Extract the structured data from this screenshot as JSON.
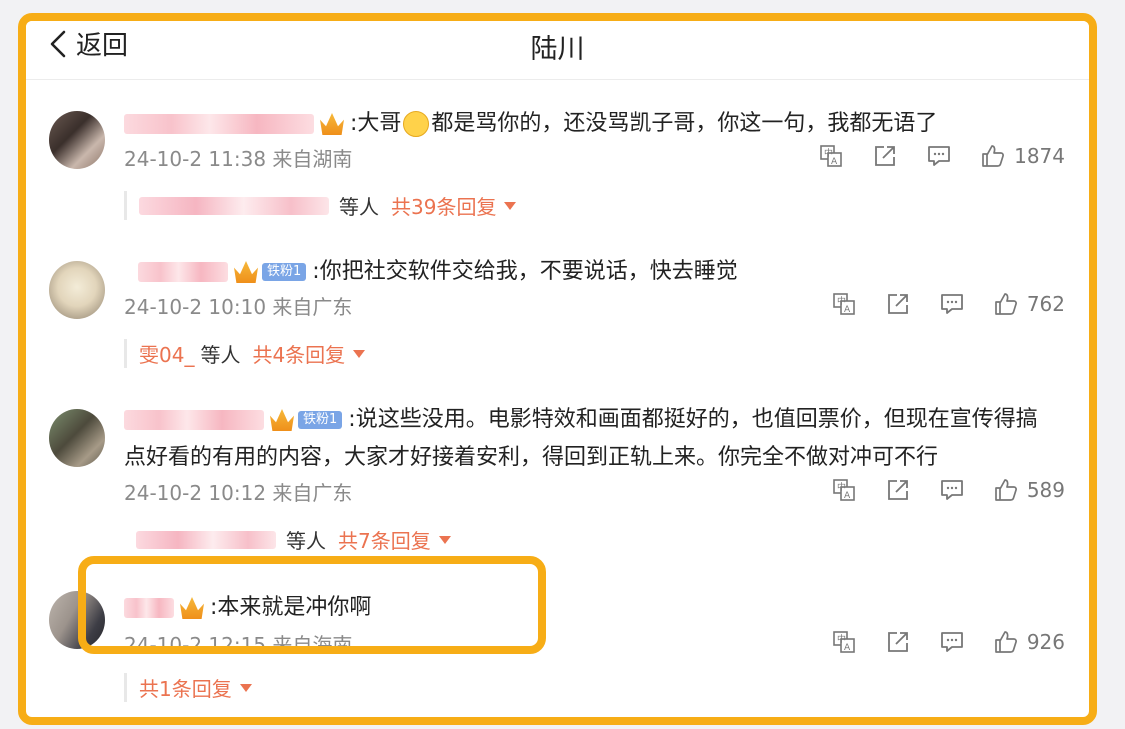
{
  "header": {
    "back_label": "返回",
    "title": "陆川"
  },
  "comments": [
    {
      "text": ":大哥",
      "text_after": "都是骂你的，还没骂凯子哥，你这一句，我都无语了",
      "time": "24-10-2 11:38",
      "source": "来自湖南",
      "likes": "1874",
      "replies_suffix": "等人",
      "reply_count": "共39条回复"
    },
    {
      "badge": "铁粉1",
      "text": ":你把社交软件交给我，不要说话，快去睡觉",
      "time": "24-10-2 10:10",
      "source": "来自广东",
      "likes": "762",
      "replier": "雯04_",
      "replies_suffix": "等人",
      "reply_count": "共4条回复"
    },
    {
      "badge": "铁粉1",
      "text": ":说这些没用。电影特效和画面都挺好的，也值回票价，但现在宣传得搞",
      "text_line2": "点好看的有用的内容，大家才好接着安利，得回到正轨上来。你完全不做对冲可不行",
      "time": "24-10-2 10:12",
      "source": "来自广东",
      "likes": "589",
      "replies_suffix": "等人",
      "reply_count": "共7条回复"
    },
    {
      "text": ":本来就是冲你啊",
      "time": "24-10-2 12:15",
      "source": "来自海南",
      "likes": "926",
      "reply_count": "共1条回复"
    }
  ],
  "icons": {
    "back": "chevron-left-icon",
    "translate": "translate-icon",
    "share": "share-icon",
    "comment": "comment-icon",
    "like": "thumbs-up-icon"
  },
  "colors": {
    "highlight": "#f7ad16",
    "link": "#eb7350"
  }
}
